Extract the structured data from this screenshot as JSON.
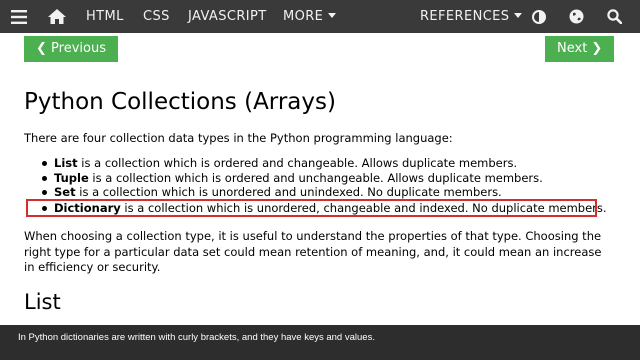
{
  "nav": {
    "menu_icon": "hamburger-menu-icon",
    "home_icon": "home-icon",
    "html": "HTML",
    "css": "CSS",
    "javascript": "JAVASCRIPT",
    "more": "MORE",
    "references": "REFERENCES",
    "contrast_icon": "contrast-icon",
    "globe_icon": "globe-icon",
    "search_icon": "search-icon",
    "bg_color": "#3a3a3a"
  },
  "pager": {
    "previous": "❮ Previous",
    "next": "Next ❯",
    "color": "#4caf50"
  },
  "article": {
    "title": "Python Collections (Arrays)",
    "intro": "There are four collection data types in the Python programming language:",
    "items": [
      {
        "term": "List",
        "desc": " is a collection which is ordered and changeable. Allows duplicate members."
      },
      {
        "term": "Tuple",
        "desc": " is a collection which is ordered and unchangeable. Allows duplicate members."
      },
      {
        "term": "Set",
        "desc": " is a collection which is unordered and unindexed. No duplicate members."
      },
      {
        "term": "Dictionary",
        "desc": " is a collection which is unordered, changeable and indexed. No duplicate members."
      }
    ],
    "paragraph": "When choosing a collection type, it is useful to understand the properties of that type. Choosing the right type for a particular data set could mean retention of meaning, and, it could mean an increase in efficiency or security.",
    "subheading": "List",
    "highlight_color": "#d32f2f"
  },
  "caption": {
    "text": "In Python dictionaries are written with curly brackets, and they have keys and values."
  }
}
